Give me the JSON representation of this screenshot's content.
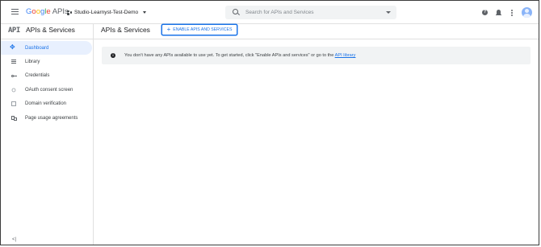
{
  "topbar": {
    "logo": {
      "google": "Google",
      "apis": "APIs"
    },
    "project_name": "Studio-Learnyst-Test-Demo",
    "search_placeholder": "Search for APIs and Services",
    "help_glyph": "?"
  },
  "sidebar": {
    "logo_text": "API",
    "title": "APIs & Services",
    "items": [
      {
        "label": "Dashboard",
        "icon": "dashboard-icon",
        "active": true
      },
      {
        "label": "Library",
        "icon": "library-icon"
      },
      {
        "label": "Credentials",
        "icon": "key-icon"
      },
      {
        "label": "OAuth consent screen",
        "icon": "oauth-icon"
      },
      {
        "label": "Domain verification",
        "icon": "domain-icon"
      },
      {
        "label": "Page usage agreements",
        "icon": "page-usage-icon"
      }
    ],
    "collapse_glyph": "<|"
  },
  "main": {
    "title": "APIs & Services",
    "enable_button": {
      "plus": "+",
      "label": "ENABLE APIS AND SERVICES"
    },
    "banner": {
      "text": "You don't have any APIs available to use yet. To get started, click \"Enable APIs and services\" or go to the ",
      "link": "API library",
      "icon_glyph": "i"
    }
  },
  "colors": {
    "accent": "#1a73e8",
    "active_bg": "#e8f0fe",
    "banner_bg": "#f1f3f4"
  }
}
